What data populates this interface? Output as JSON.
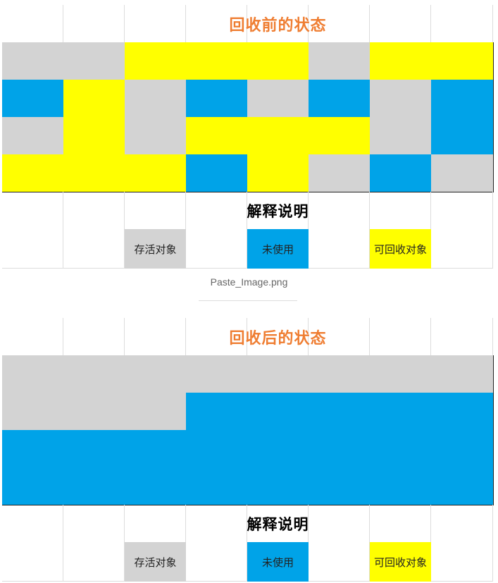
{
  "colors": {
    "live": "#d3d3d3",
    "unused": "#00a3e8",
    "collectable": "#ffff00",
    "title": "#ef7d31"
  },
  "legend": {
    "title": "解释说明",
    "items": [
      {
        "key": "live",
        "label": "存活对象"
      },
      {
        "key": "unused",
        "label": "未使用"
      },
      {
        "key": "collectable",
        "label": "可回收对象"
      }
    ]
  },
  "before": {
    "title": "回收前的状态",
    "grid": [
      [
        "live",
        "live",
        "collectable",
        "collectable",
        "collectable",
        "live",
        "collectable",
        "collectable"
      ],
      [
        "unused",
        "collectable",
        "live",
        "unused",
        "live",
        "unused",
        "live",
        "unused"
      ],
      [
        "live",
        "collectable",
        "live",
        "collectable",
        "collectable",
        "collectable",
        "live",
        "unused"
      ],
      [
        "collectable",
        "collectable",
        "collectable",
        "unused",
        "collectable",
        "live",
        "unused",
        "live"
      ]
    ]
  },
  "caption": "Paste_Image.png",
  "after": {
    "title": "回收后的状态",
    "grid": [
      [
        "live",
        "live",
        "live",
        "live",
        "live",
        "live",
        "live",
        "live"
      ],
      [
        "live",
        "live",
        "live",
        "unused",
        "unused",
        "unused",
        "unused",
        "unused"
      ],
      [
        "unused",
        "unused",
        "unused",
        "unused",
        "unused",
        "unused",
        "unused",
        "unused"
      ],
      [
        "unused",
        "unused",
        "unused",
        "unused",
        "unused",
        "unused",
        "unused",
        "unused"
      ]
    ]
  }
}
